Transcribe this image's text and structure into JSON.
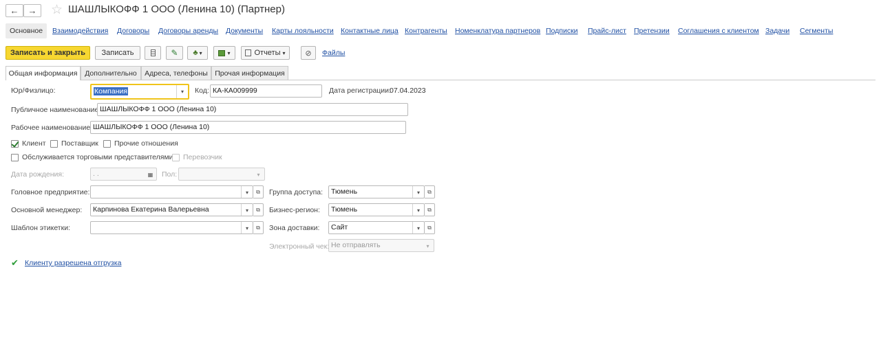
{
  "window": {
    "back_icon": "←",
    "forward_icon": "→",
    "star_icon": "☆",
    "title": "ШАШЛЫКОФФ 1 ООО (Ленина 10) (Партнер)"
  },
  "nav_tabs": {
    "active": "Основное",
    "links": [
      "Взаимодействия",
      "Договоры",
      "Договоры аренды",
      "Документы",
      "Карты лояльности",
      "Контактные лица",
      "Контрагенты",
      "Номенклатура партнеров",
      "Подписки",
      "Прайс-лист",
      "Претензии",
      "Соглашения с клиентом",
      "Задачи",
      "Сегменты"
    ]
  },
  "toolbar": {
    "save_close": "Записать и закрыть",
    "save": "Записать",
    "reports": "Отчеты",
    "files": "Файлы",
    "dropdown_icon": "▾"
  },
  "page_tabs": [
    "Общая информация",
    "Дополнительно",
    "Адреса, телефоны",
    "Прочая информация"
  ],
  "form": {
    "legal_type_label": "Юр/Физлицо:",
    "legal_type_value": "Компания",
    "code_label": "Код:",
    "code_value": "КА-КА009999",
    "reg_date_label": "Дата регистрации:",
    "reg_date_value": "07.04.2023",
    "public_name_label": "Публичное наименование:",
    "public_name_value": "ШАШЛЫКОФФ 1 ООО (Ленина 10)",
    "work_name_label": "Рабочее наименование:",
    "work_name_value": "ШАШЛЫКОФФ 1 ООО (Ленина 10)",
    "checkboxes": {
      "client": "Клиент",
      "supplier": "Поставщик",
      "other": "Прочие отношения",
      "served_by_reps": "Обслуживается торговыми представителями",
      "carrier": "Перевозчик"
    },
    "birth_date_label": "Дата рождения:",
    "birth_date_value": "  .  .",
    "sex_label": "Пол:",
    "head_company_label": "Головное предприятие:",
    "head_company_value": "",
    "main_manager_label": "Основной менеджер:",
    "main_manager_value": "Карпинова Екатерина Валерьевна",
    "label_template_label": "Шаблон этикетки:",
    "label_template_value": "",
    "access_group_label": "Группа доступа:",
    "access_group_value": "Тюмень",
    "business_region_label": "Бизнес-регион:",
    "business_region_value": "Тюмень",
    "delivery_zone_label": "Зона доставки:",
    "delivery_zone_value": "Сайт",
    "e_receipt_label": "Электронный чек:",
    "e_receipt_value": "Не отправлять",
    "shipment_link": "Клиенту разрешена отгрузка"
  },
  "colors": {
    "primary_button": "#f7d731",
    "link": "#1f4fa3",
    "check": "#2e7d32"
  }
}
